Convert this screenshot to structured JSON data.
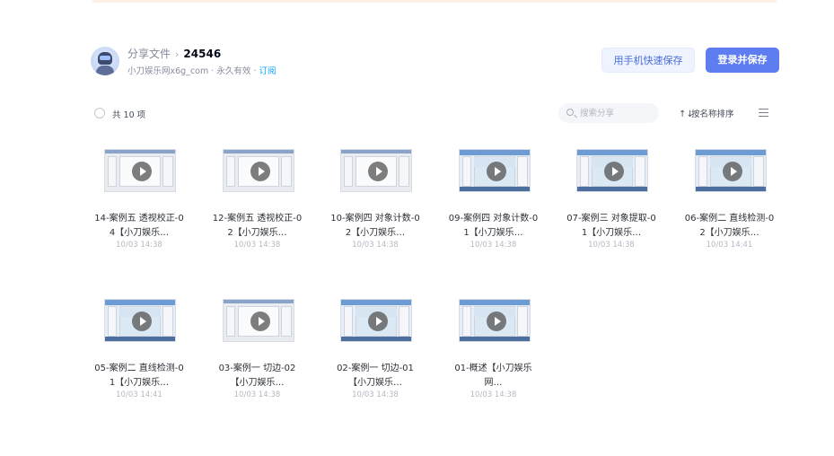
{
  "header": {
    "title_label": "分享文件",
    "title_separator": "›",
    "title_name": "24546",
    "owner": "小刀娱乐网x6g_com",
    "validity": "永久有效",
    "subscribe_label": "订阅",
    "dot": "·"
  },
  "actions": {
    "phone_save_label": "用手机快速保存",
    "login_save_label": "登录并保存"
  },
  "toolbar": {
    "count_text": "共 10 项",
    "search_placeholder": "搜索分享",
    "sort_icon": "↑↓",
    "sort_label": "按名称排序"
  },
  "files": [
    {
      "name": "14-案例五 透视校正-04【小刀娱乐…",
      "date": "10/03 14:38",
      "thumb": "plain"
    },
    {
      "name": "12-案例五 透视校正-02【小刀娱乐…",
      "date": "10/03 14:38",
      "thumb": "plain"
    },
    {
      "name": "10-案例四 对象计数-02【小刀娱乐…",
      "date": "10/03 14:38",
      "thumb": "plain"
    },
    {
      "name": "09-案例四 对象计数-01【小刀娱乐…",
      "date": "10/03 14:38",
      "thumb": "alt"
    },
    {
      "name": "07-案例三 对象提取-01【小刀娱乐…",
      "date": "10/03 14:38",
      "thumb": "alt"
    },
    {
      "name": "06-案例二 直线检测-02【小刀娱乐…",
      "date": "10/03 14:41",
      "thumb": "alt"
    },
    {
      "name": "05-案例二 直线检测-01【小刀娱乐…",
      "date": "10/03 14:41",
      "thumb": "alt"
    },
    {
      "name": "03-案例一 切边-02【小刀娱乐…",
      "date": "10/03 14:38",
      "thumb": "plain"
    },
    {
      "name": "02-案例一 切边-01【小刀娱乐…",
      "date": "10/03 14:38",
      "thumb": "alt"
    },
    {
      "name": "01-概述【小刀娱乐网…",
      "date": "10/03 14:38",
      "thumb": "alt"
    }
  ]
}
